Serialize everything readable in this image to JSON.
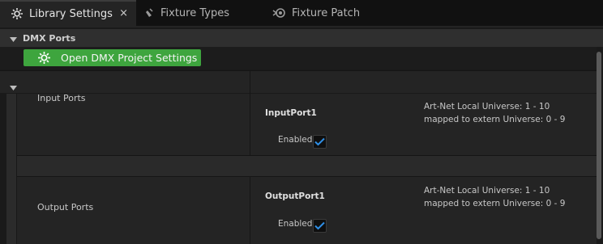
{
  "tabs": [
    {
      "label": "Library Settings",
      "icon": "gear-icon",
      "active": true,
      "close": "×"
    },
    {
      "label": "Fixture Types",
      "icon": "fixture-types-icon",
      "active": false
    },
    {
      "label": "Fixture Patch",
      "icon": "fixture-patch-icon",
      "active": false
    }
  ],
  "category": {
    "title": "DMX Ports"
  },
  "settings_button": {
    "label": "Open DMX Project Settings",
    "color": "#3ea53e"
  },
  "input": {
    "section_label": "Input Ports",
    "port_name": "InputPort1",
    "enabled_label": "Enabled",
    "enabled": true,
    "info_line1": "Art-Net Local Universe: 1 - 10",
    "info_line2": "mapped to extern Universe: 0 - 9"
  },
  "output": {
    "section_label": "Output Ports",
    "port_name": "OutputPort1",
    "enabled_label": "Enabled",
    "enabled": true,
    "info_line1": "Art-Net Local Universe: 1 - 10",
    "info_line2": "mapped to extern Universe: 0 - 9"
  },
  "colors": {
    "accent_green": "#3ea53e",
    "check_blue": "#2f8fe6",
    "background": "#1a1a1a"
  }
}
